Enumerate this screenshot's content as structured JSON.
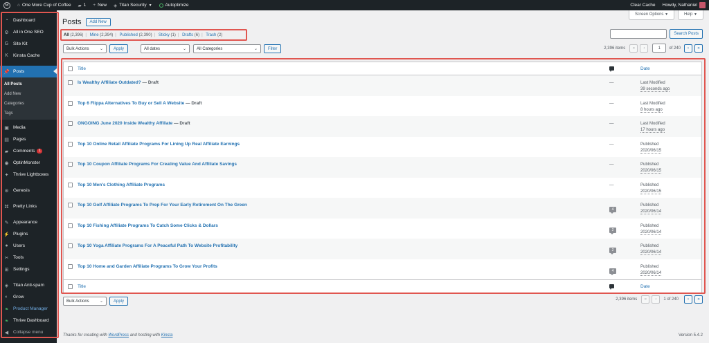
{
  "adminbar": {
    "site_name": "One More Cup of Coffee",
    "comments_count": "1",
    "new_label": "New",
    "titan_label": "Titan Security",
    "autoptimize_label": "Autoptimize",
    "clear_cache": "Clear Cache",
    "howdy": "Howdy, Nathaniel"
  },
  "sidebar": {
    "items": [
      {
        "label": "Dashboard"
      },
      {
        "label": "All in One SEO"
      },
      {
        "label": "Site Kit"
      },
      {
        "label": "Kinsta Cache"
      },
      {
        "label": "Posts"
      },
      {
        "label": "Media"
      },
      {
        "label": "Pages"
      },
      {
        "label": "Comments",
        "badge": "1"
      },
      {
        "label": "OptinMonster"
      },
      {
        "label": "Thrive Lightboxes"
      },
      {
        "label": "Genesis"
      },
      {
        "label": "Pretty Links"
      },
      {
        "label": "Appearance"
      },
      {
        "label": "Plugins"
      },
      {
        "label": "Users"
      },
      {
        "label": "Tools"
      },
      {
        "label": "Settings"
      },
      {
        "label": "Titan Anti-spam"
      },
      {
        "label": "Grow"
      },
      {
        "label": "Product Manager"
      },
      {
        "label": "Thrive Dashboard"
      },
      {
        "label": "Collapse menu"
      }
    ],
    "posts_sub": [
      "All Posts",
      "Add New",
      "Categories",
      "Tags"
    ]
  },
  "header": {
    "title": "Posts",
    "add_new": "Add New",
    "screen_options": "Screen Options",
    "help": "Help"
  },
  "filters": {
    "views": [
      {
        "label": "All",
        "count": "(2,396)"
      },
      {
        "label": "Mine",
        "count": "(2,394)"
      },
      {
        "label": "Published",
        "count": "(2,390)"
      },
      {
        "label": "Sticky",
        "count": "(1)"
      },
      {
        "label": "Drafts",
        "count": "(6)"
      },
      {
        "label": "Trash",
        "count": "(2)"
      }
    ],
    "bulk_actions": "Bulk Actions",
    "apply": "Apply",
    "all_dates": "All dates",
    "all_categories": "All Categories",
    "filter": "Filter",
    "search_button": "Search Posts"
  },
  "pagination": {
    "items": "2,396 items",
    "current_page": "1",
    "of_total": "of 240",
    "bottom_text": "1 of 240"
  },
  "table": {
    "col_title": "Title",
    "col_date": "Date",
    "rows": [
      {
        "title": "Is Wealthy Affiliate Outdated?",
        "state": " — Draft",
        "comments": "—",
        "status": "Last Modified",
        "date": "39 seconds ago"
      },
      {
        "title": "Top 6 Flippa Alternatives To Buy or Sell A Website",
        "state": " — Draft",
        "comments": "—",
        "status": "Last Modified",
        "date": "8 hours ago"
      },
      {
        "title": "ONGOING June 2020 Inside Wealthy Affiliate",
        "state": " — Draft",
        "comments": "—",
        "status": "Last Modified",
        "date": "17 hours ago"
      },
      {
        "title": "Top 10 Online Retail Affiliate Programs For Lining Up Real Affiliate Earnings",
        "state": "",
        "comments": "—",
        "status": "Published",
        "date": "2020/06/15"
      },
      {
        "title": "Top 10 Coupon Affiliate Programs For Creating Value And Affiliate Savings",
        "state": "",
        "comments": "—",
        "status": "Published",
        "date": "2020/06/15"
      },
      {
        "title": "Top 10 Men's Clothing Affiliate Programs",
        "state": "",
        "comments": "—",
        "status": "Published",
        "date": "2020/06/15"
      },
      {
        "title": "Top 10 Golf Affiliate Programs To Prep For Your Early Retirement On The Green",
        "state": "",
        "comments": "4",
        "status": "Published",
        "date": "2020/06/14"
      },
      {
        "title": "Top 10 Fishing Affiliate Programs To Catch Some Clicks & Dollars",
        "state": "",
        "comments": "2",
        "status": "Published",
        "date": "2020/06/14"
      },
      {
        "title": "Top 10 Yoga Affiliate Programs For A Peaceful Path To Website Profitability",
        "state": "",
        "comments": "2",
        "status": "Published",
        "date": "2020/06/14"
      },
      {
        "title": "Top 10 Home and Garden Affiliate Programs To Grow Your Profits",
        "state": "",
        "comments": "4",
        "status": "Published",
        "date": "2020/06/14"
      }
    ]
  },
  "footer": {
    "pre": "Thanks for creating with ",
    "wordpress": "WordPress",
    "mid": " and hosting with ",
    "kinsta": "Kinsta",
    "version": "Version 5.4.2"
  }
}
